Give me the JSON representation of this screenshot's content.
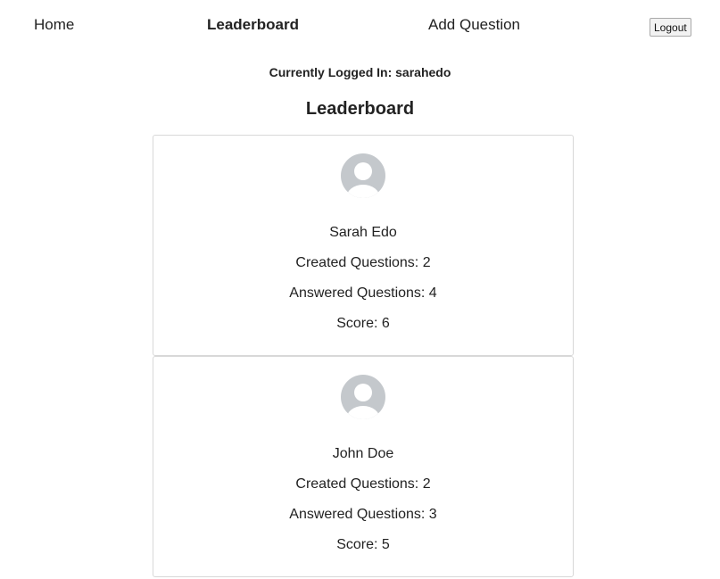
{
  "nav": {
    "home": "Home",
    "leaderboard": "Leaderboard",
    "add_question": "Add Question",
    "logout": "Logout"
  },
  "session": {
    "logged_in_text": "Currently Logged In: sarahedo"
  },
  "page": {
    "title": "Leaderboard"
  },
  "leaderboard": [
    {
      "avatar": "default-user-avatar-icon",
      "name": "Sarah Edo",
      "created": "Created Questions: 2",
      "answered": "Answered Questions: 4",
      "score": "Score: 6"
    },
    {
      "avatar": "default-user-avatar-icon",
      "name": "John Doe",
      "created": "Created Questions: 2",
      "answered": "Answered Questions: 3",
      "score": "Score: 5"
    }
  ],
  "colors": {
    "avatar_fill": "#c4c8cc",
    "card_border": "#d8d8d8"
  }
}
